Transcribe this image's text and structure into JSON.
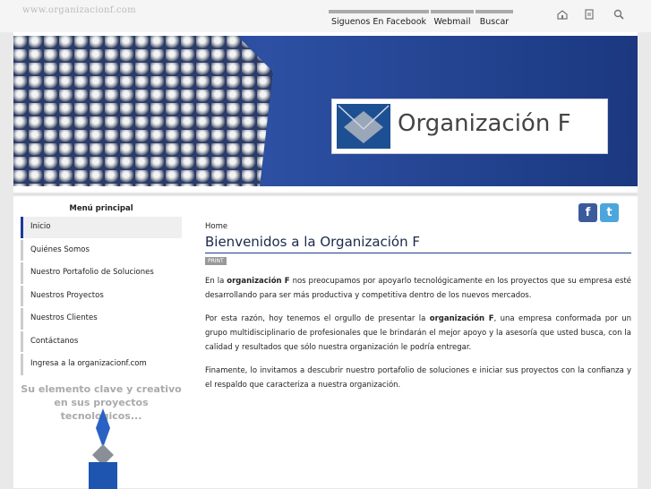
{
  "site": {
    "url": "www.organizacionf.com"
  },
  "topnav": {
    "items": [
      "Siguenos En Facebook",
      "Webmail",
      "Buscar"
    ]
  },
  "tools": [
    "home-icon",
    "sitemap-icon",
    "search-icon"
  ],
  "banner": {
    "logo_text": "Organización F"
  },
  "sidebar": {
    "title": "Menú principal",
    "items": [
      "Inicio",
      "Quiénes Somos",
      "Nuestro Portafolio de Soluciones",
      "Nuestros Proyectos",
      "Nuestros Clientes",
      "Contáctanos",
      "Ingresa a la organizacionf.com"
    ],
    "tagline": "Su elemento clave y creativo en sus proyectos tecnologicos..."
  },
  "main": {
    "breadcrumb": "Home",
    "title": "Bienvenidos a la Organización F",
    "print_label": "PRINT",
    "p1_a": "En la ",
    "p1_b": "organización F",
    "p1_c": " nos preocupamos por apoyarlo tecnológicamente en los proyectos que su empresa esté desarrollando para ser más productiva y competitiva dentro de los nuevos mercados.",
    "p2_a": "Por esta razón, hoy tenemos el orgullo de presentar la ",
    "p2_b": "organización F",
    "p2_c": ", una empresa conformada por un grupo multidisciplinario de profesionales que le brindarán el mejor apoyo y la asesoría que usted busca, con la calidad y resultados que sólo nuestra organización le podría entregar.",
    "p3": "Finamente, lo invitamos a descubrir nuestro portafolio de soluciones e iniciar sus proyectos con la confianza y el respaldo que caracteriza a nuestra organización."
  },
  "colors": {
    "accent": "#1c3d8c",
    "brand_blue": "#1d4f93"
  }
}
